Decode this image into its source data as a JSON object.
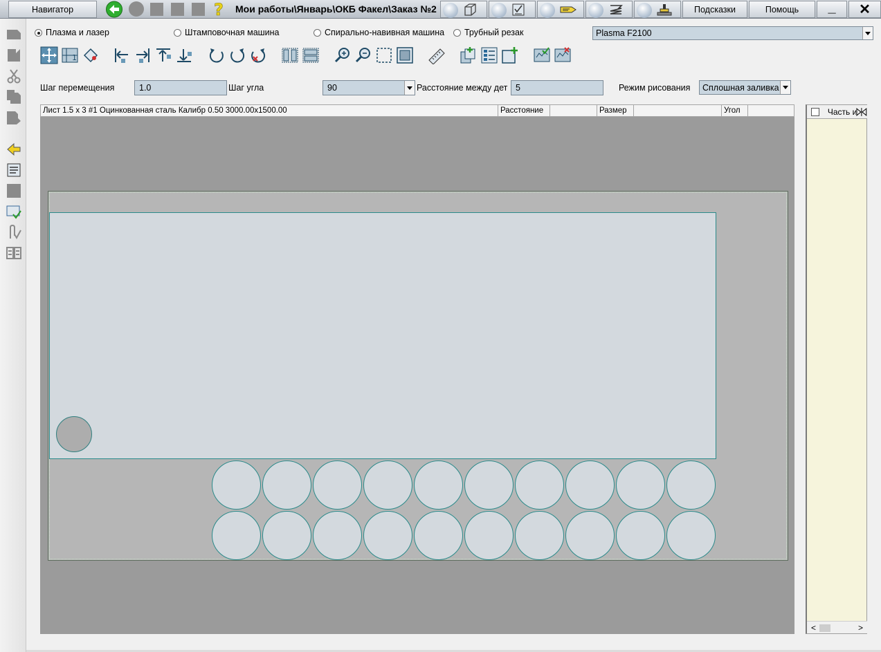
{
  "titlebar": {
    "navigator_label": "Навигатор",
    "path": "Мои работы\\Январь\\ОКБ Факел\\Заказ №2",
    "hints_label": "Подсказки",
    "help_label": "Помощь",
    "minimize_glyph": "_",
    "close_glyph": "✕",
    "help_glyph": "?"
  },
  "machine_types": [
    {
      "label": "Плазма и лазер",
      "selected": true
    },
    {
      "label": "Штамповочная машина",
      "selected": false
    },
    {
      "label": "Спирально-навивная машина",
      "selected": false
    },
    {
      "label": "Трубный резак",
      "selected": false
    }
  ],
  "machine_select": {
    "value": "Plasma F2100"
  },
  "settings": {
    "move_step_label": "Шаг перемещения",
    "move_step_value": "1.0",
    "angle_step_label": "Шаг угла",
    "angle_step_value": "90",
    "distance_label": "Расстояние между дет",
    "distance_value": "5",
    "draw_mode_label": "Режим рисования",
    "draw_mode_value": "Сплошная заливка"
  },
  "grid": {
    "sheet_info": "Лист 1.5 x 3 #1 Оцинкованная сталь Калибр 0.50 3000.00x1500.00",
    "col_distance": "Расстояние",
    "col_size": "Размер",
    "col_angle": "Угол"
  },
  "right_panel": {
    "header": "Часть и",
    "scroll_left": "<",
    "scroll_right": ">"
  },
  "colors": {
    "canvas_bg": "#9b9b9b",
    "sheet_bg": "#b6b6b6",
    "part_fill": "#d3d9de",
    "part_stroke": "#2a8a8a",
    "field_bg": "#c9d6e0",
    "panel_bg": "#f6f4dc"
  },
  "parts": {
    "large_circle_rows": 2,
    "large_circles_per_row": 10,
    "small_circles": 1,
    "rectangular_plates": 1
  }
}
